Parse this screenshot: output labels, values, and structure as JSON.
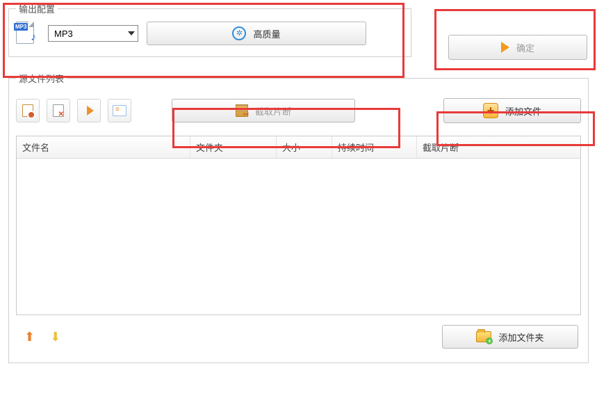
{
  "output_config": {
    "legend": "输出配置",
    "format_icon": "mp3-file-icon",
    "format_selected": "MP3",
    "quality_button": "高质量"
  },
  "confirm": {
    "label": "确定"
  },
  "source_list": {
    "legend": "源文件列表",
    "toolbar": {
      "icon1": "document-stop-icon",
      "icon2": "document-delete-icon",
      "icon3": "play-icon",
      "icon4": "properties-icon"
    },
    "clip_button": "截取片断",
    "add_file_button": "添加文件",
    "columns": {
      "name": "文件名",
      "folder": "文件夹",
      "size": "大小",
      "duration": "持续时间",
      "clip": "截取片断"
    },
    "rows": [],
    "move_up_icon": "arrow-up-icon",
    "move_down_icon": "arrow-down-icon",
    "add_folder_button": "添加文件夹"
  }
}
